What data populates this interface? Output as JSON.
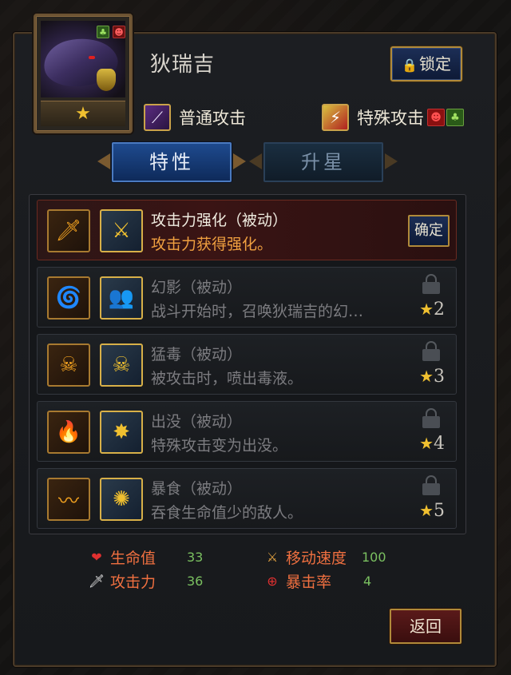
{
  "character": {
    "name": "狄瑞吉",
    "stars": "★",
    "lock_label": "锁定",
    "lock_icon": "padlock-icon"
  },
  "attacks": {
    "normal_label": "普通攻击",
    "special_label": "特殊攻击"
  },
  "tabs": [
    {
      "label": "特性",
      "active": true
    },
    {
      "label": "升星",
      "active": false
    }
  ],
  "skills": [
    {
      "title": "攻击力强化（被动）",
      "desc": "攻击力获得强化。",
      "action": "确定",
      "unlocked": true
    },
    {
      "title": "幻影（被动）",
      "desc": "战斗开始时，召唤狄瑞吉的幻…",
      "req": "2",
      "unlocked": false
    },
    {
      "title": "猛毒（被动）",
      "desc": "被攻击时，喷出毒液。",
      "req": "3",
      "unlocked": false
    },
    {
      "title": "出没（被动）",
      "desc": "特殊攻击变为出没。",
      "req": "4",
      "unlocked": false
    },
    {
      "title": "暴食（被动）",
      "desc": "吞食生命值少的敌人。",
      "req": "5",
      "unlocked": false
    }
  ],
  "stats": {
    "hp_label": "生命值",
    "hp_value": "33",
    "atk_label": "攻击力",
    "atk_value": "36",
    "speed_label": "移动速度",
    "speed_value": "100",
    "crit_label": "暴击率",
    "crit_value": "4"
  },
  "return_label": "返回",
  "colors": {
    "accent_gold": "#b08a3a",
    "active_tab": "#1e4a8e",
    "skill_active_desc": "#f0a040",
    "stat_label": "#f07040",
    "stat_value": "#7ac060"
  }
}
